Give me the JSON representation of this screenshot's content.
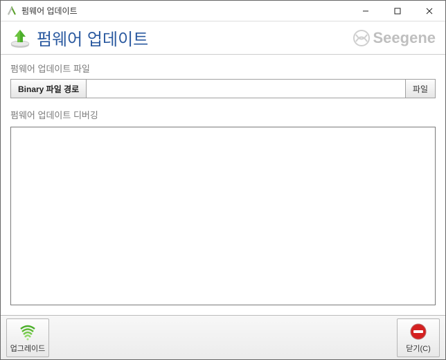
{
  "window": {
    "title": "펌웨어 업데이트"
  },
  "header": {
    "title": "펌웨어 업데이트",
    "brand": "Seegene"
  },
  "file_section": {
    "label": "펌웨어 업데이트 파일",
    "field_title": "Binary 파일 경로",
    "path_value": "",
    "browse_label": "파일"
  },
  "debug_section": {
    "label": "펌웨어 업데이트 디버깅",
    "content": ""
  },
  "footer": {
    "upgrade_label": "업그레이드",
    "close_label": "닫기(C)"
  }
}
